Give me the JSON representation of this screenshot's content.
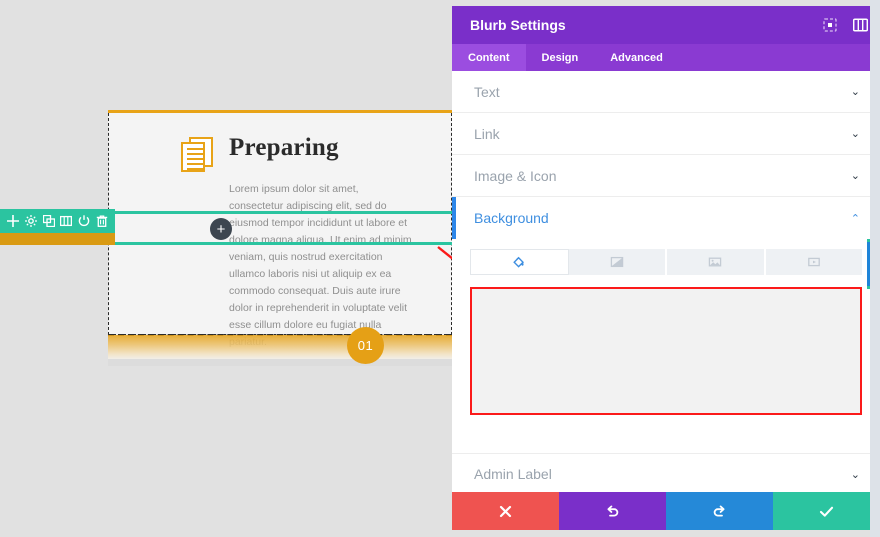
{
  "canvas": {
    "module": {
      "title": "Preparing",
      "body": "Lorem ipsum dolor sit amet, consectetur adipiscing elit, sed do eiusmod tempor incididunt ut labore et dolore magna aliqua. Ut enim ad minim veniam, quis nostrud exercitation ullamco laboris nisi ut aliquip ex ea commodo consequat. Duis aute irure dolor in reprehenderit in voluptate velit esse cillum dolore eu fugiat nulla pariatur.",
      "badge": "01",
      "icon": "document-stack-icon",
      "accent_color": "#e8a317",
      "badge_color": "#e5a016"
    },
    "toolbar": {
      "color": "#2bc4a0",
      "items": [
        {
          "name": "move-icon",
          "title": "Move"
        },
        {
          "name": "gear-icon",
          "title": "Settings"
        },
        {
          "name": "duplicate-icon",
          "title": "Duplicate"
        },
        {
          "name": "columns-icon",
          "title": "Columns"
        },
        {
          "name": "power-icon",
          "title": "Disable"
        },
        {
          "name": "trash-icon",
          "title": "Delete"
        }
      ]
    },
    "selection": {
      "outline_color": "#2bc4a0",
      "add_button_label": "+"
    },
    "annotation": {
      "arrow_color": "#fb1a1a",
      "highlight_color": "#fb1a1a"
    }
  },
  "panel": {
    "title": "Blurb Settings",
    "header_color": "#7a2fc9",
    "header_icons": [
      {
        "name": "focus-icon",
        "title": "Focus"
      },
      {
        "name": "layout-icon",
        "title": "Layout"
      }
    ],
    "tabs": [
      {
        "label": "Content",
        "active": true
      },
      {
        "label": "Design",
        "active": false
      },
      {
        "label": "Advanced",
        "active": false
      }
    ],
    "sections": [
      {
        "label": "Text",
        "open": false
      },
      {
        "label": "Link",
        "open": false
      },
      {
        "label": "Image & Icon",
        "open": false
      },
      {
        "label": "Background",
        "open": true
      }
    ],
    "background_tabs": [
      {
        "name": "background-color-tab",
        "icon": "paint-bucket-icon",
        "active": true
      },
      {
        "name": "background-gradient-tab",
        "icon": "gradient-icon",
        "active": false
      },
      {
        "name": "background-image-tab",
        "icon": "image-icon",
        "active": false
      },
      {
        "name": "background-video-tab",
        "icon": "video-icon",
        "active": false
      }
    ],
    "admin_label": {
      "label": "Admin Label",
      "open": false
    },
    "footer_buttons": [
      {
        "name": "cancel-button",
        "icon": "close-icon",
        "color": "#ef5350"
      },
      {
        "name": "undo-button",
        "icon": "undo-icon",
        "color": "#7a2fc9"
      },
      {
        "name": "redo-button",
        "icon": "redo-icon",
        "color": "#2589d8"
      },
      {
        "name": "save-button",
        "icon": "check-icon",
        "color": "#2bc4a0"
      }
    ],
    "chevron_closed": "⌄",
    "chevron_open": "⌃"
  }
}
